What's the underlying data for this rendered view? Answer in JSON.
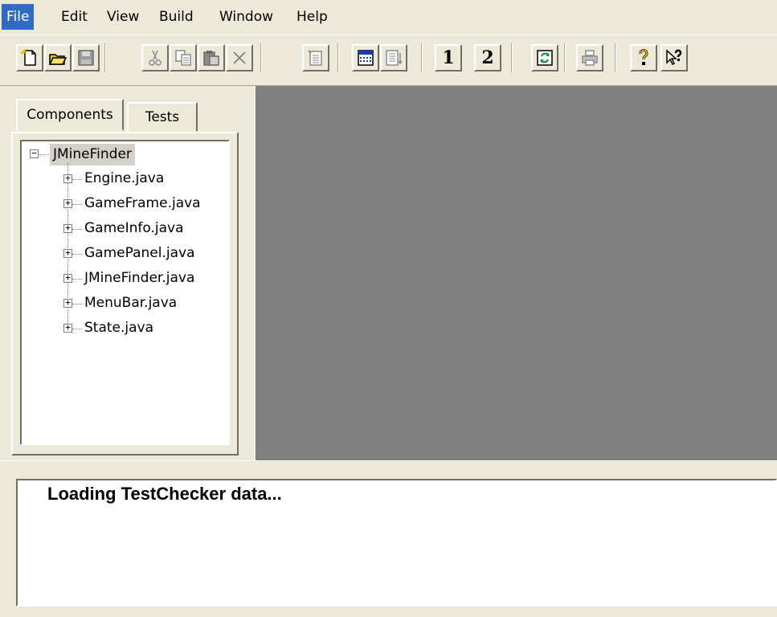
{
  "menubar": {
    "items": [
      "File",
      "Edit",
      "View",
      "Build",
      "Window",
      "Help"
    ]
  },
  "toolbar": {
    "icons": [
      "new-icon",
      "open-icon",
      "save-icon",
      "cut-icon",
      "copy-icon",
      "paste-icon",
      "delete-icon",
      "new-test-icon",
      "grid-icon",
      "list-icon",
      "one-icon",
      "two-icon",
      "refresh-icon",
      "print-icon",
      "help-icon",
      "context-help-icon"
    ],
    "num1_label": "1",
    "num2_label": "2"
  },
  "tabs": [
    {
      "label": "Components",
      "selected": true
    },
    {
      "label": "Tests",
      "selected": false
    }
  ],
  "tree": {
    "root": "JMineFinder",
    "items": [
      "Engine.java",
      "GameFrame.java",
      "GameInfo.java",
      "GamePanel.java",
      "JMineFinder.java",
      "MenuBar.java",
      "State.java"
    ]
  },
  "log": {
    "text": "Loading TestChecker data..."
  },
  "colors": {
    "menu_highlight": "#316ac5",
    "workspace": "#808080",
    "chrome": "#ece9d8"
  }
}
